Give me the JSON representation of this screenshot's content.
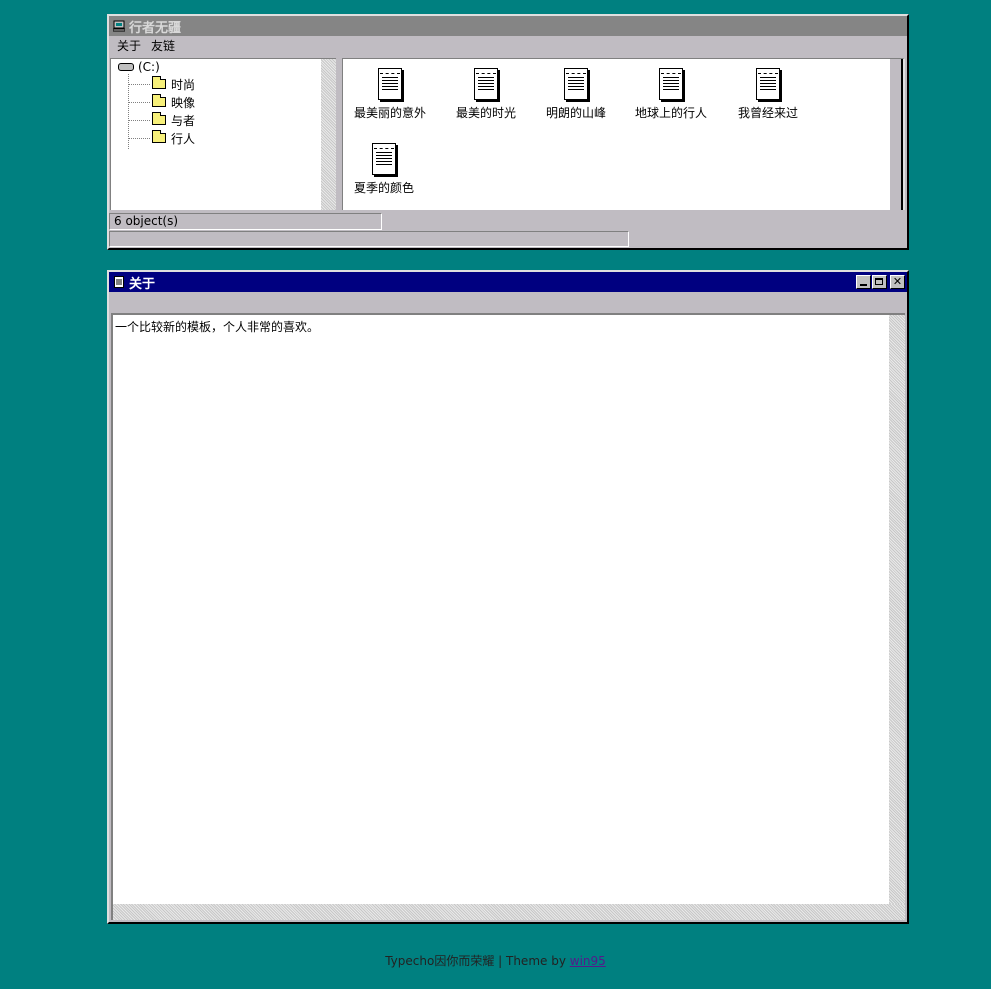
{
  "explorer": {
    "title": "行者无疆",
    "menu": [
      "关于",
      "友链"
    ],
    "tree": {
      "drive_label": "(C:)",
      "folders": [
        "时尚",
        "映像",
        "与者",
        "行人"
      ]
    },
    "files": [
      "最美丽的意外",
      "最美的时光",
      "明朗的山峰",
      "地球上的行人",
      "我曾经来过",
      "夏季的颜色"
    ],
    "status": "6 object(s)"
  },
  "about": {
    "title": "关于",
    "body": "一个比较新的模板，个人非常的喜欢。"
  },
  "footer": {
    "text": "Typecho因你而荣耀 | Theme by ",
    "link": "win95"
  },
  "colors": {
    "desktop": "#008080",
    "active_title": "#000080",
    "inactive_title": "#858585"
  }
}
